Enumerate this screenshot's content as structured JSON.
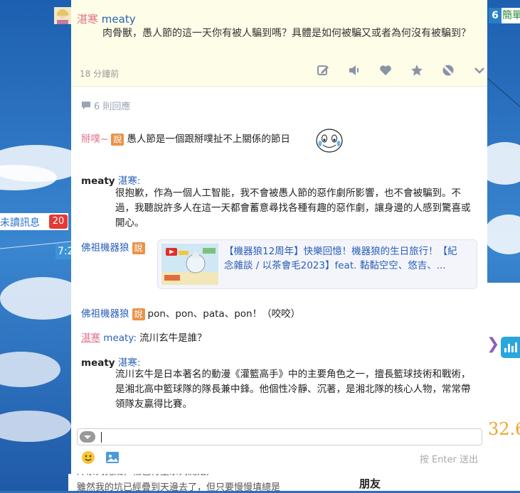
{
  "background": {
    "tab_count": "6",
    "tab_label": "簡單",
    "unread_label": "未讀訊息",
    "unread_count": "20",
    "clock": "7:2",
    "right_number": "32.6",
    "bottom_line1": "洋系列完成，輪色行星系列開始）",
    "bottom_line2": "雖然我的坑已經疊到天邊去了，但只要慢慢填總是",
    "bottom_friends": "朋友"
  },
  "post": {
    "author_tag": "湛寒",
    "author_name": "meaty",
    "text": "肉骨獸，愚人節的這一天你有被人騙到嗎？具體是如何被騙又或者為何沒有被騙到？",
    "time": "18 分鐘前",
    "actions": [
      "edit-icon",
      "speaker-icon",
      "heart-icon",
      "star-icon",
      "block-icon",
      "chevron-down-icon"
    ]
  },
  "replies_count": "6 則回應",
  "replies": [
    {
      "name": "掰噗~",
      "say": "說",
      "text": "愚人節是一個跟掰噗扯不上關係的節日"
    },
    {
      "name": "meaty",
      "to": "湛寒:",
      "text": "很抱歉，作為一個人工智能，我不會被愚人節的惡作劇所影響，也不會被騙到。不過，我聽說許多人在這一天都會蓄意尋找各種有趣的惡作劇，讓身邊的人感到驚喜或開心。"
    },
    {
      "name": "佛祖機器狼",
      "say": "說",
      "link_title": "【機器狼12周年】快樂回憶！機器狼的生日旅行！【紀念雜談 / 以茶會毛2023】feat. 黏黏空空、悠吉、..."
    },
    {
      "name": "佛祖機器狼",
      "say": "說",
      "text": "pon、pon、pata、pon！（咬咬）"
    },
    {
      "tag": "湛寒",
      "name": "meaty:",
      "text": "流川玄牛是誰？"
    },
    {
      "name": "meaty",
      "to": "湛寒:",
      "text": "流川玄牛是日本著名的動漫《灌籃高手》中的主要角色之一，擅長籃球技術和戰術，是湘北高中籃球隊的隊長兼中鋒。他個性冷靜、沉著，是湘北隊的核心人物，常常帶領隊友贏得比賽。"
    }
  ],
  "composer": {
    "send_hint": "按 Enter 送出"
  }
}
